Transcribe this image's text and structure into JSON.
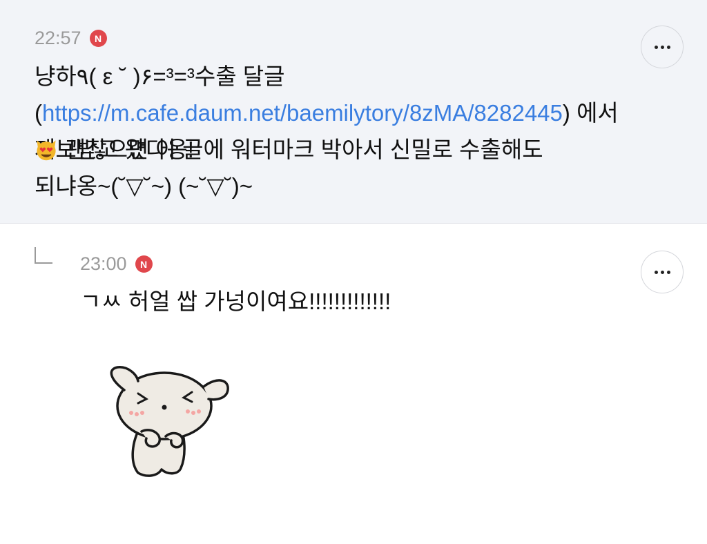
{
  "comments": [
    {
      "time": "22:57",
      "badge": "N",
      "text_part1": "냥하٩( ε ˘ )۶=³=³수출 달글(",
      "link": "https://m.cafe.daum.net/baemilytory/8zMA/8282445",
      "text_part2": ") 에서 제보받고 왔다옹!",
      "line3": "괜찮으면 이 글에 워터마크 박아서 신밀로 수출해도",
      "line4": "되냐옹~(˘▽˘~) (~˘▽˘)~",
      "emoji": "smiling-cat-heart-eyes"
    },
    {
      "time": "23:00",
      "badge": "N",
      "text": "ㄱㅆ 허얼 쌉 가넝이여요!!!!!!!!!!!!!",
      "sticker": "bear-sticker"
    }
  ],
  "colors": {
    "accent_link": "#3a7ee0",
    "badge": "#e0474c",
    "top_bg": "#f2f4f8"
  }
}
